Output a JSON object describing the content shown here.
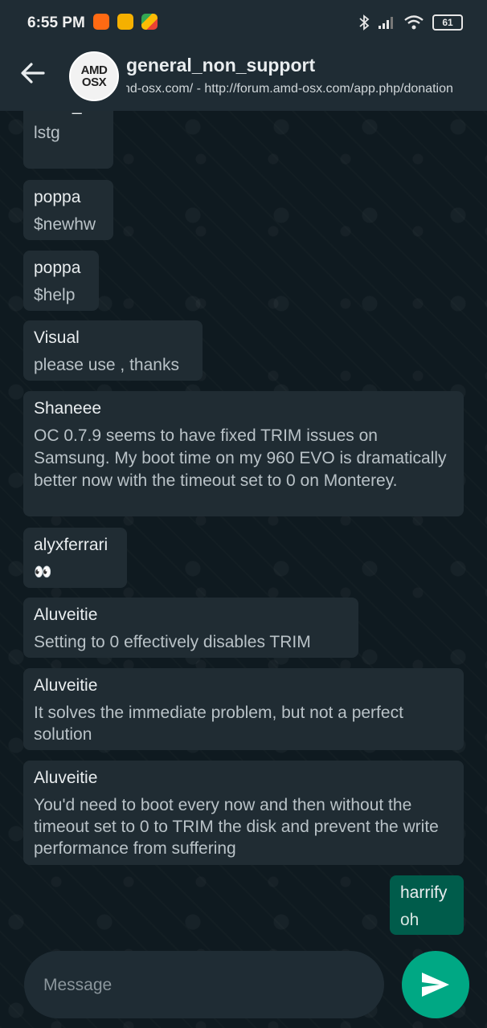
{
  "status_bar": {
    "time": "6:55 PM",
    "battery": "61"
  },
  "header": {
    "avatar_line1": "AMD",
    "avatar_line2": "OSX",
    "title": "general_non_support",
    "subtitle": "nd-osx.com/ - http://forum.amd-osx.com/app.php/donation"
  },
  "messages": [
    {
      "sender": "dallis_c",
      "text": "lstg"
    },
    {
      "sender": "poppa",
      "text": "$newhw"
    },
    {
      "sender": "poppa",
      "text": "$help"
    },
    {
      "sender": "Visual",
      "text": "please use , thanks"
    },
    {
      "sender": "Shaneee",
      "text": "OC 0.7.9 seems to have fixed TRIM issues on Samsung. My boot time on my 960 EVO is dramatically better now with the timeout set to 0 on Monterey."
    },
    {
      "sender": "alyxferrari",
      "text": "👀"
    },
    {
      "sender": "Aluveitie",
      "text": "Setting to 0 effectively disables TRIM"
    },
    {
      "sender": "Aluveitie",
      "text": "It solves the immediate problem, but not a perfect solution"
    },
    {
      "sender": "Aluveitie",
      "text": "You'd need to boot every now and then without the timeout set to 0 to TRIM the disk and prevent the write performance from suffering"
    },
    {
      "sender": "harrify",
      "text": "oh",
      "outgoing": true
    }
  ],
  "composer": {
    "placeholder": "Message"
  },
  "colors": {
    "header_bg": "#1f2c34",
    "incoming_bubble": "#202c33",
    "outgoing_bubble": "#005c4b",
    "send_button": "#00a884"
  }
}
